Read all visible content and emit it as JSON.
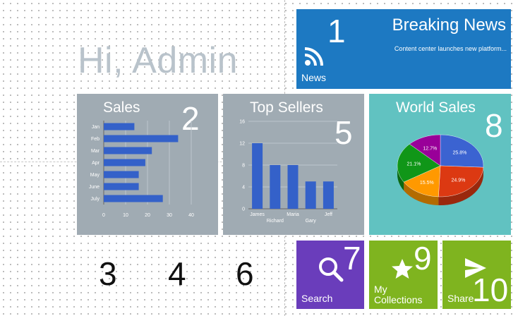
{
  "greeting": "Hi, Admin",
  "colors": {
    "news": "#1d79c2",
    "chart_tile": "#a0abb3",
    "world": "#61c2c1",
    "search": "#6a3dbb",
    "green": "#7fb41f",
    "bar": "#3461c9"
  },
  "tiles": {
    "news": {
      "title": "Breaking News",
      "subtitle": "Content center launches new platform...",
      "label": "News",
      "number": "1",
      "icon": "rss-icon"
    },
    "sales": {
      "title": "Sales",
      "number": "2"
    },
    "top_sellers": {
      "title": "Top Sellers",
      "number": "5"
    },
    "world_sales": {
      "title": "World Sales",
      "number": "8"
    },
    "search": {
      "label": "Search",
      "number": "7",
      "icon": "search-icon"
    },
    "collections": {
      "label": "My Collections",
      "number": "9",
      "icon": "star-icon"
    },
    "share": {
      "label": "Share",
      "number": "10",
      "icon": "send-icon"
    }
  },
  "loose_numbers": [
    "3",
    "4",
    "6"
  ],
  "chart_data": [
    {
      "type": "bar",
      "orientation": "horizontal",
      "categories": [
        "Jan",
        "Feb",
        "Mar",
        "Apr",
        "May",
        "June",
        "July"
      ],
      "values": [
        14,
        34,
        22,
        19,
        16,
        16,
        27
      ],
      "xlim": [
        0,
        40
      ],
      "xticks": [
        "0",
        "10",
        "20",
        "30",
        "40"
      ],
      "grid": true,
      "color": "#3461c9"
    },
    {
      "type": "bar",
      "categories": [
        "James",
        "Richard",
        "Maria",
        "Gary",
        "Jeff"
      ],
      "values": [
        12,
        8,
        8,
        5,
        5
      ],
      "ylim": [
        0,
        16
      ],
      "yticks": [
        "0",
        "4",
        "8",
        "12",
        "16"
      ],
      "grid": true,
      "color": "#3461c9"
    },
    {
      "type": "pie",
      "style": "3d",
      "slices": [
        {
          "label": "25.8%",
          "value": 25.8,
          "color": "#3b63d1"
        },
        {
          "label": "24.9%",
          "value": 24.9,
          "color": "#dc3912"
        },
        {
          "label": "15.5%",
          "value": 15.5,
          "color": "#ff9900"
        },
        {
          "label": "21.1%",
          "value": 21.1,
          "color": "#109618"
        },
        {
          "label": "12.7%",
          "value": 12.7,
          "color": "#990099"
        }
      ]
    }
  ]
}
